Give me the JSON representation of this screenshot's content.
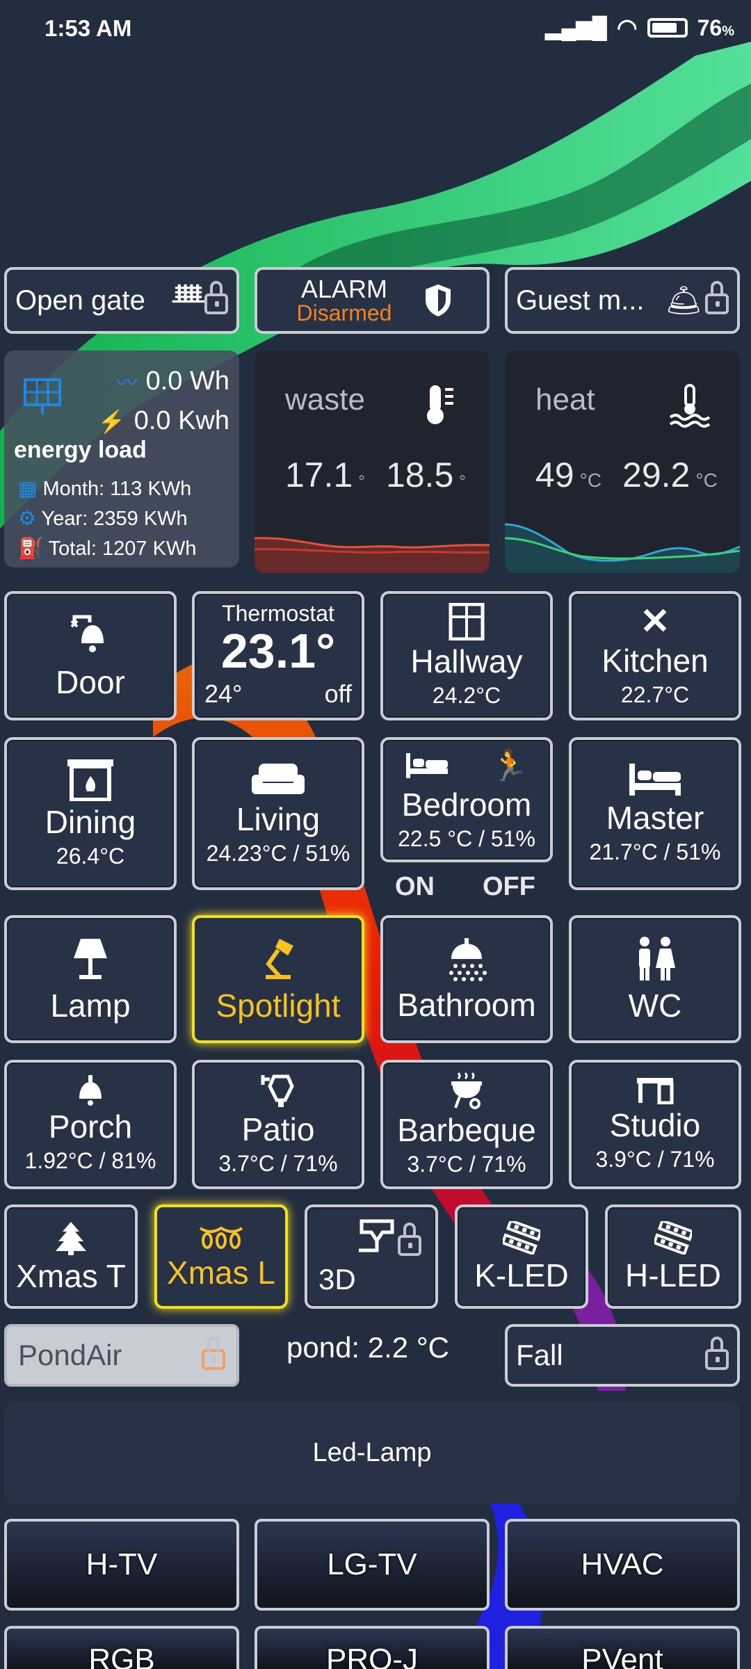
{
  "status": {
    "time": "1:53 AM",
    "battery": "76"
  },
  "header_row": {
    "gate": "Open gate",
    "alarm_title": "ALARM",
    "alarm_state": "Disarmed",
    "guest": "Guest m..."
  },
  "energy": {
    "power": "0.0 Wh",
    "energy": "0.0 Kwh",
    "title": "energy load",
    "month": "Month: 113 KWh",
    "year": "Year: 2359 KWh",
    "total": "Total: 1207 KWh"
  },
  "waste": {
    "title": "waste",
    "v1": "17.1",
    "u1": "°",
    "v2": "18.5",
    "u2": "°"
  },
  "heat": {
    "title": "heat",
    "v1": "49",
    "u1": "°C",
    "v2": "29.2",
    "u2": "°C"
  },
  "tiles": {
    "door": {
      "name": "Door"
    },
    "thermostat": {
      "title": "Thermostat",
      "temp": "23.1°",
      "target": "24°",
      "mode": "off"
    },
    "hallway": {
      "name": "Hallway",
      "sub": "24.2°C"
    },
    "kitchen": {
      "name": "Kitchen",
      "sub": "22.7°C"
    },
    "dining": {
      "name": "Dining",
      "sub": "26.4°C"
    },
    "living": {
      "name": "Living",
      "sub": "24.23°C / 51%"
    },
    "bedroom": {
      "name": "Bedroom",
      "sub": "22.5 °C / 51%"
    },
    "master": {
      "name": "Master",
      "sub": "21.7°C / 51%"
    },
    "lamp": {
      "name": "Lamp"
    },
    "spotlight": {
      "name": "Spotlight"
    },
    "bathroom": {
      "name": "Bathroom"
    },
    "wc": {
      "name": "WC"
    },
    "porch": {
      "name": "Porch",
      "sub": "1.92°C / 81%"
    },
    "patio": {
      "name": "Patio",
      "sub": "3.7°C / 71%"
    },
    "barbeque": {
      "name": "Barbeque",
      "sub": "3.7°C / 71%"
    },
    "studio": {
      "name": "Studio",
      "sub": "3.9°C / 71%"
    },
    "xmas_t": {
      "name": "Xmas T"
    },
    "xmas_l": {
      "name": "Xmas L"
    },
    "printer3d": {
      "name": "3D"
    },
    "k_led": {
      "name": "K-LED"
    },
    "h_led": {
      "name": "H-LED"
    }
  },
  "on_off": {
    "on": "ON",
    "off": "OFF"
  },
  "pond": {
    "air": "PondAir",
    "temp": "pond: 2.2 °C",
    "fall": "Fall"
  },
  "led_lamp": "Led-Lamp",
  "buttons": {
    "htv": "H-TV",
    "lgtv": "LG-TV",
    "hvac": "HVAC",
    "rgb": "RGB",
    "projector": "PRO-J",
    "vent": "PVent"
  },
  "colors": {
    "accent_orange": "#f5821f",
    "accent_yellow": "#f6c221",
    "motion_green": "#2ecc71",
    "energy_blue": "#1e88e5"
  }
}
